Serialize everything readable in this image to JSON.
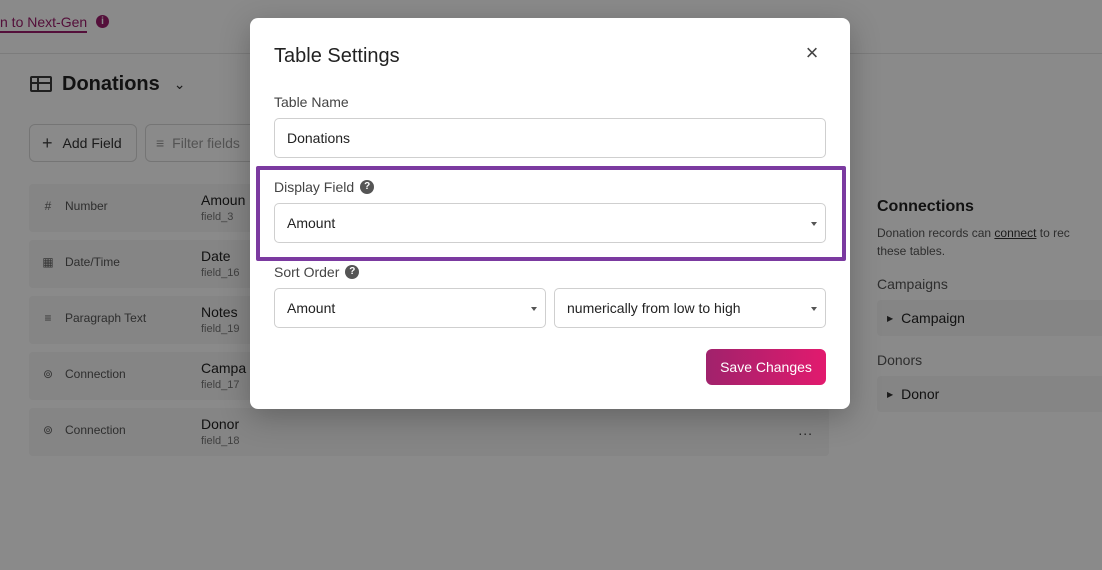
{
  "topbar": {
    "link_text": "n to Next-Gen",
    "info_icon": "info-icon"
  },
  "table": {
    "title": "Donations",
    "icon": "table-icon",
    "chevron": "chevron-down-icon"
  },
  "toolbar": {
    "add_field_label": "Add Field",
    "filter_placeholder": "Filter fields"
  },
  "fields": [
    {
      "type": "Number",
      "type_icon": "hash-icon",
      "name": "Amoun",
      "key": "field_3"
    },
    {
      "type": "Date/Time",
      "type_icon": "calendar-icon",
      "name": "Date",
      "key": "field_16"
    },
    {
      "type": "Paragraph Text",
      "type_icon": "paragraph-icon",
      "name": "Notes",
      "key": "field_19"
    },
    {
      "type": "Connection",
      "type_icon": "connection-icon",
      "name": "Campa",
      "key": "field_17"
    },
    {
      "type": "Connection",
      "type_icon": "connection-icon",
      "name": "Donor",
      "key": "field_18",
      "menu": "..."
    }
  ],
  "connections": {
    "title": "Connections",
    "desc_prefix": "Donation records can ",
    "desc_link": "connect",
    "desc_suffix": " to rec",
    "desc_line2": "these tables.",
    "groups": [
      {
        "label": "Campaigns",
        "item": "Campaign"
      },
      {
        "label": "Donors",
        "item": "Donor"
      }
    ]
  },
  "modal": {
    "title": "Table Settings",
    "close_icon": "close-icon",
    "table_name_label": "Table Name",
    "table_name_value": "Donations",
    "display_field_label": "Display Field",
    "display_field_value": "Amount",
    "sort_order_label": "Sort Order",
    "sort_field_value": "Amount",
    "sort_direction_value": "numerically from low to high",
    "save_label": "Save Changes"
  },
  "colors": {
    "brand": "#9b1d6b",
    "save_gradient_start": "#a0226c",
    "save_gradient_end": "#e21a6e",
    "highlight": "#7b3aa0"
  }
}
